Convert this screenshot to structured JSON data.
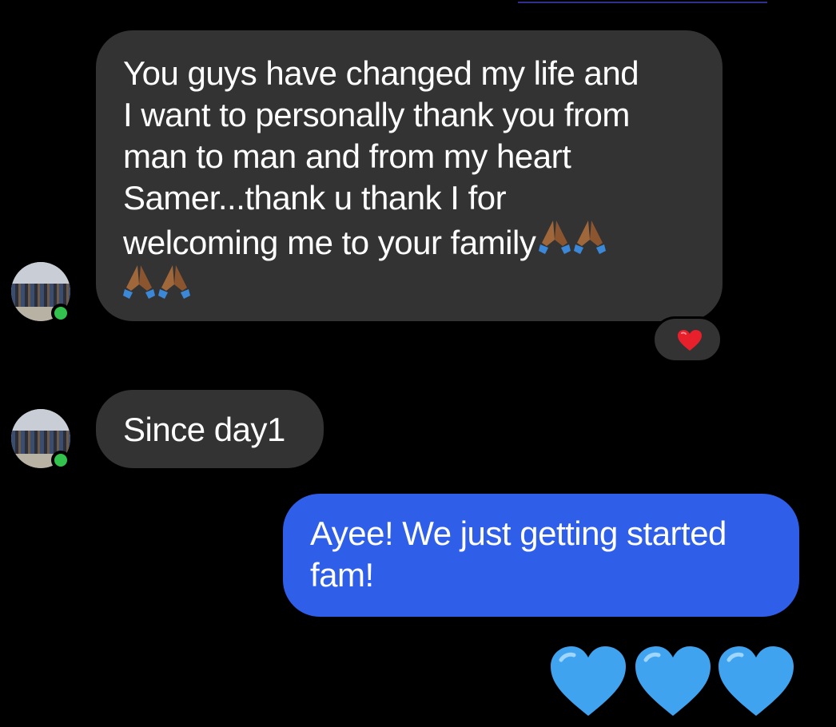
{
  "conversation": {
    "messages": [
      {
        "direction": "incoming",
        "lines": [
          "You guys have changed my life and",
          "I want to personally thank you from",
          "man to man and from my heart",
          "Samer...thank u thank I for",
          "welcoming me to your family"
        ],
        "emoji": [
          "folded-hands",
          "folded-hands",
          "folded-hands",
          "folded-hands"
        ],
        "reaction": "red-heart"
      },
      {
        "direction": "incoming",
        "lines": [
          "Since day1"
        ]
      },
      {
        "direction": "outgoing",
        "lines": [
          "Ayee! We just getting started",
          "fam!"
        ]
      },
      {
        "direction": "outgoing",
        "emoji": [
          "blue-heart",
          "blue-heart",
          "blue-heart"
        ]
      }
    ]
  },
  "colors": {
    "background": "#000000",
    "incoming_bubble": "#333333",
    "outgoing_bubble": "#2f5fe8",
    "online_indicator": "#33c24d",
    "reaction_heart": "#e8202c",
    "blue_heart": "#3fa3f0"
  }
}
